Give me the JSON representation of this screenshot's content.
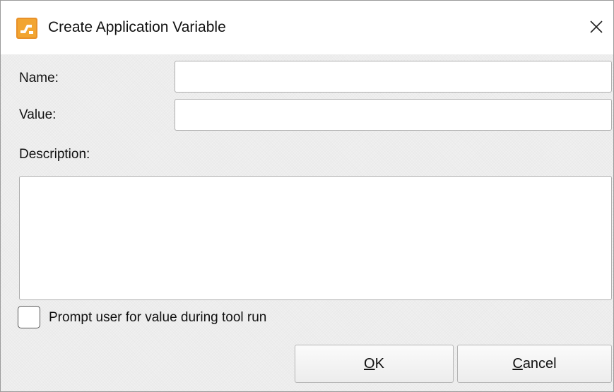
{
  "dialog": {
    "title": "Create Application Variable",
    "app_icon": "pdf-xchange-app-icon",
    "close_icon": "close-x-icon",
    "name_label": "Name:",
    "name_value": "",
    "value_label": "Value:",
    "value_value": "",
    "description_label": "Description:",
    "description_value": "",
    "prompt_checkbox_label": "Prompt user for value during tool run",
    "prompt_checked": false,
    "ok_mnemonic": "O",
    "ok_rest": "K",
    "cancel_mnemonic": "C",
    "cancel_rest": "ancel"
  },
  "colors": {
    "background": "#f0f0f0",
    "titlebar": "#ffffff",
    "icon_orange": "#e8912a",
    "field_border": "#adadad"
  }
}
